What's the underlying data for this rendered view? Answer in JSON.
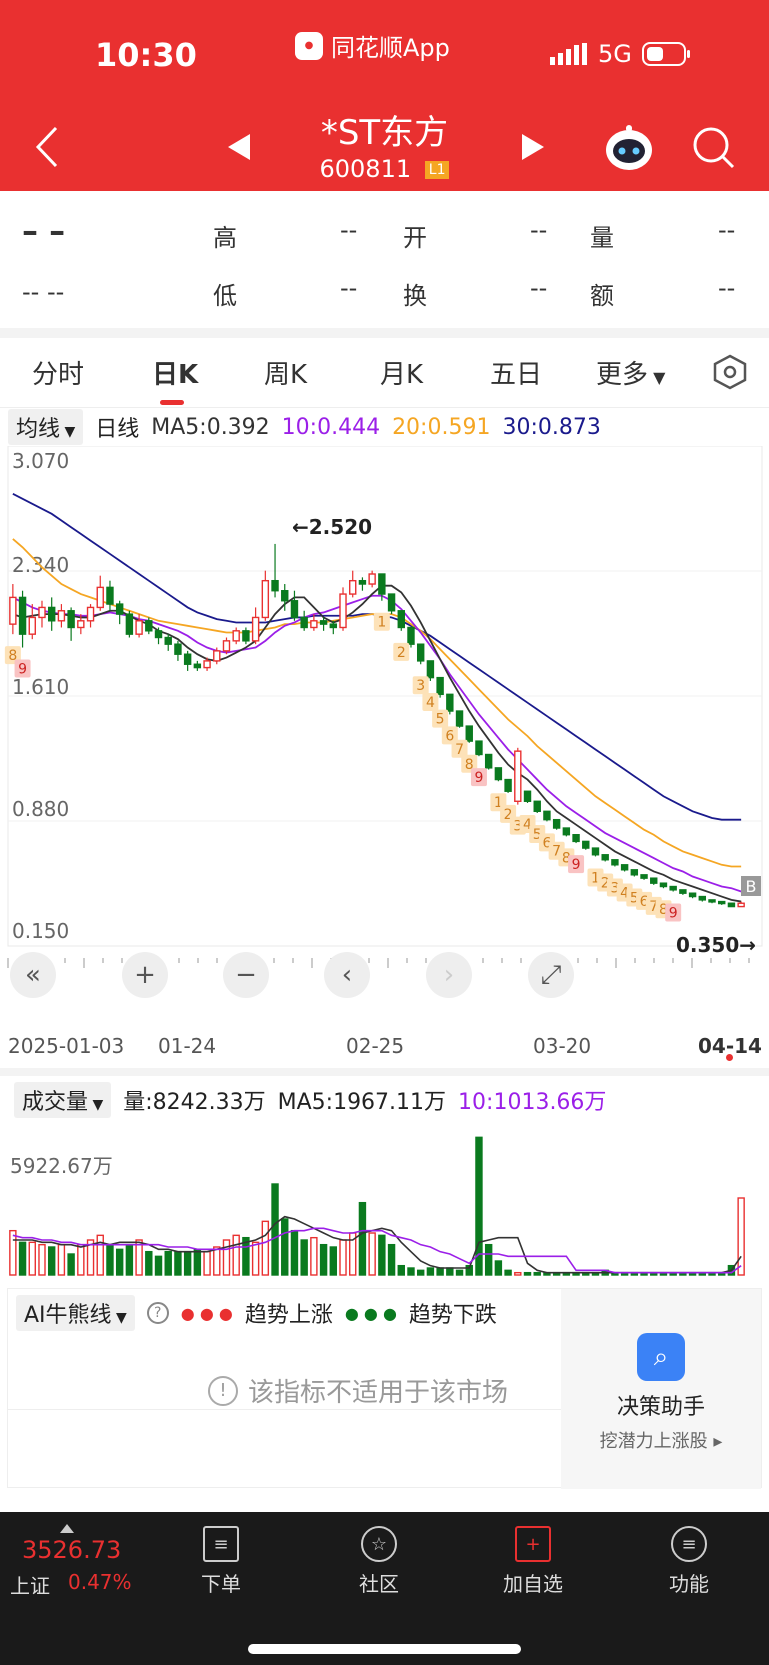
{
  "status": {
    "time": "10:30",
    "app": "同花顺App",
    "network": "5G"
  },
  "header": {
    "title": "*ST东方",
    "code": "600811",
    "badge": "L1"
  },
  "quote": {
    "price": "– –",
    "change": "-- --",
    "labels": [
      "高",
      "开",
      "量",
      "低",
      "换",
      "额"
    ],
    "values": [
      "--",
      "--",
      "--",
      "--",
      "--",
      "--"
    ]
  },
  "tabs": [
    "分时",
    "日K",
    "周K",
    "月K",
    "五日",
    "更多"
  ],
  "ma": {
    "select": "均线",
    "period": "日线",
    "ma5": "MA5:0.392",
    "ma10": "10:0.444",
    "ma20": "20:0.591",
    "ma30": "30:0.873"
  },
  "colors": {
    "red": "#e93030",
    "green": "#0a7a1f",
    "ma5": "#333333",
    "ma10": "#9b1fe8",
    "ma20": "#f5a623",
    "ma30": "#1a1a8c"
  },
  "chart_labels": {
    "high": "←2.520",
    "low": "0.350→",
    "y_ticks": [
      "3.070",
      "2.340",
      "1.610",
      "0.880",
      "0.150"
    ],
    "x_ticks": [
      "2025-01-03",
      "01-24",
      "02-25",
      "03-20",
      "04-14"
    ],
    "marker_b": "B"
  },
  "chart_data": {
    "type": "candlestick",
    "ylim": [
      0.15,
      3.07
    ],
    "x_ticks": [
      "2025-01-03",
      "01-24",
      "02-25",
      "03-20",
      "04-14"
    ],
    "candles": [
      [
        2.04,
        2.2,
        2.28,
        1.98
      ],
      [
        2.2,
        1.98,
        2.24,
        1.9
      ],
      [
        1.98,
        2.08,
        2.16,
        1.95
      ],
      [
        2.08,
        2.14,
        2.18,
        2.02
      ],
      [
        2.14,
        2.06,
        2.2,
        2.0
      ],
      [
        2.06,
        2.12,
        2.16,
        2.02
      ],
      [
        2.12,
        2.02,
        2.14,
        1.94
      ],
      [
        2.02,
        2.06,
        2.1,
        1.98
      ],
      [
        2.06,
        2.14,
        2.16,
        2.02
      ],
      [
        2.14,
        2.26,
        2.33,
        2.12
      ],
      [
        2.26,
        2.16,
        2.3,
        2.12
      ],
      [
        2.16,
        2.1,
        2.18,
        2.04
      ],
      [
        2.1,
        1.98,
        2.12,
        1.96
      ],
      [
        1.98,
        2.06,
        2.1,
        1.96
      ],
      [
        2.06,
        2.0,
        2.08,
        1.98
      ],
      [
        2.0,
        1.96,
        2.02,
        1.92
      ],
      [
        1.96,
        1.92,
        1.98,
        1.88
      ],
      [
        1.92,
        1.86,
        1.94,
        1.82
      ],
      [
        1.86,
        1.8,
        1.88,
        1.76
      ],
      [
        1.8,
        1.78,
        1.82,
        1.76
      ],
      [
        1.78,
        1.82,
        1.84,
        1.76
      ],
      [
        1.82,
        1.88,
        1.9,
        1.8
      ],
      [
        1.88,
        1.94,
        1.96,
        1.86
      ],
      [
        1.94,
        2.0,
        2.02,
        1.92
      ],
      [
        2.0,
        1.94,
        2.02,
        1.92
      ],
      [
        1.94,
        2.08,
        2.14,
        1.92
      ],
      [
        2.08,
        2.3,
        2.36,
        2.06
      ],
      [
        2.3,
        2.24,
        2.52,
        2.2
      ],
      [
        2.24,
        2.18,
        2.28,
        2.12
      ],
      [
        2.18,
        2.08,
        2.24,
        2.06
      ],
      [
        2.08,
        2.02,
        2.12,
        2.0
      ],
      [
        2.02,
        2.06,
        2.1,
        2.0
      ],
      [
        2.06,
        2.04,
        2.08,
        2.0
      ],
      [
        2.04,
        2.02,
        2.06,
        1.98
      ],
      [
        2.02,
        2.22,
        2.26,
        2.0
      ],
      [
        2.22,
        2.3,
        2.36,
        2.2
      ],
      [
        2.3,
        2.28,
        2.32,
        2.24
      ],
      [
        2.28,
        2.34,
        2.36,
        2.26
      ],
      [
        2.34,
        2.22,
        2.34,
        2.18
      ],
      [
        2.22,
        2.12,
        2.22,
        2.1
      ],
      [
        2.12,
        2.02,
        2.12,
        2.0
      ],
      [
        2.02,
        1.92,
        2.02,
        1.9
      ],
      [
        1.92,
        1.82,
        1.92,
        1.8
      ],
      [
        1.82,
        1.72,
        1.82,
        1.7
      ],
      [
        1.72,
        1.62,
        1.72,
        1.6
      ],
      [
        1.62,
        1.52,
        1.62,
        1.5
      ],
      [
        1.52,
        1.43,
        1.52,
        1.42
      ],
      [
        1.43,
        1.34,
        1.43,
        1.33
      ],
      [
        1.34,
        1.26,
        1.34,
        1.25
      ],
      [
        1.26,
        1.18,
        1.26,
        1.17
      ],
      [
        1.18,
        1.11,
        1.18,
        1.1
      ],
      [
        1.11,
        1.04,
        1.11,
        1.03
      ],
      [
        0.98,
        1.28,
        1.3,
        0.96
      ],
      [
        1.04,
        0.98,
        1.04,
        0.97
      ],
      [
        0.98,
        0.92,
        0.98,
        0.91
      ],
      [
        0.92,
        0.87,
        0.92,
        0.86
      ],
      [
        0.87,
        0.82,
        0.87,
        0.81
      ],
      [
        0.82,
        0.78,
        0.82,
        0.77
      ],
      [
        0.78,
        0.74,
        0.78,
        0.73
      ],
      [
        0.74,
        0.7,
        0.74,
        0.69
      ],
      [
        0.7,
        0.66,
        0.7,
        0.65
      ],
      [
        0.66,
        0.63,
        0.66,
        0.62
      ],
      [
        0.63,
        0.6,
        0.63,
        0.59
      ],
      [
        0.6,
        0.57,
        0.6,
        0.56
      ],
      [
        0.57,
        0.54,
        0.57,
        0.53
      ],
      [
        0.54,
        0.52,
        0.54,
        0.51
      ],
      [
        0.52,
        0.49,
        0.52,
        0.48
      ],
      [
        0.49,
        0.47,
        0.49,
        0.46
      ],
      [
        0.47,
        0.45,
        0.47,
        0.44
      ],
      [
        0.45,
        0.43,
        0.45,
        0.42
      ],
      [
        0.43,
        0.41,
        0.43,
        0.4
      ],
      [
        0.41,
        0.39,
        0.41,
        0.38
      ],
      [
        0.39,
        0.38,
        0.39,
        0.37
      ],
      [
        0.38,
        0.37,
        0.38,
        0.36
      ],
      [
        0.37,
        0.35,
        0.37,
        0.35
      ],
      [
        0.35,
        0.37,
        0.38,
        0.35
      ]
    ],
    "ma_values": {
      "ma5": [
        2.1,
        2.08,
        2.09,
        2.1,
        2.1,
        2.1,
        2.09,
        2.08,
        2.08,
        2.1,
        2.12,
        2.12,
        2.09,
        2.06,
        2.04,
        2.0,
        1.98,
        1.95,
        1.9,
        1.86,
        1.83,
        1.82,
        1.84,
        1.87,
        1.9,
        1.94,
        2.02,
        2.1,
        2.16,
        2.2,
        2.2,
        2.14,
        2.08,
        2.05,
        2.07,
        2.11,
        2.16,
        2.22,
        2.27,
        2.27,
        2.23,
        2.15,
        2.05,
        1.94,
        1.83,
        1.72,
        1.62,
        1.52,
        1.43,
        1.35,
        1.27,
        1.2,
        1.15,
        1.11,
        1.05,
        0.98,
        0.92,
        0.88,
        0.84,
        0.8,
        0.76,
        0.72,
        0.68,
        0.65,
        0.62,
        0.59,
        0.56,
        0.54,
        0.51,
        0.49,
        0.47,
        0.45,
        0.43,
        0.41,
        0.39,
        0.38
      ],
      "ma10": [
        2.2,
        2.17,
        2.14,
        2.12,
        2.11,
        2.1,
        2.1,
        2.09,
        2.09,
        2.1,
        2.11,
        2.1,
        2.09,
        2.07,
        2.06,
        2.04,
        2.02,
        2.0,
        1.97,
        1.93,
        1.9,
        1.88,
        1.87,
        1.88,
        1.89,
        1.9,
        1.94,
        1.99,
        2.03,
        2.05,
        2.08,
        2.1,
        2.11,
        2.13,
        2.15,
        2.17,
        2.19,
        2.21,
        2.21,
        2.18,
        2.13,
        2.06,
        1.99,
        1.91,
        1.83,
        1.74,
        1.66,
        1.58,
        1.5,
        1.43,
        1.36,
        1.29,
        1.23,
        1.17,
        1.11,
        1.05,
        1.0,
        0.95,
        0.91,
        0.87,
        0.83,
        0.79,
        0.76,
        0.73,
        0.7,
        0.67,
        0.64,
        0.61,
        0.58,
        0.56,
        0.53,
        0.51,
        0.49,
        0.47,
        0.46,
        0.44
      ],
      "ma20": [
        2.55,
        2.5,
        2.44,
        2.38,
        2.33,
        2.28,
        2.25,
        2.22,
        2.2,
        2.18,
        2.16,
        2.14,
        2.12,
        2.1,
        2.08,
        2.06,
        2.05,
        2.04,
        2.03,
        2.02,
        2.01,
        2.0,
        1.99,
        1.99,
        1.99,
        2.0,
        2.01,
        2.02,
        2.04,
        2.04,
        2.05,
        2.05,
        2.05,
        2.06,
        2.07,
        2.08,
        2.09,
        2.1,
        2.1,
        2.1,
        2.08,
        2.04,
        2.0,
        1.95,
        1.89,
        1.83,
        1.77,
        1.71,
        1.65,
        1.59,
        1.53,
        1.47,
        1.42,
        1.37,
        1.31,
        1.26,
        1.21,
        1.16,
        1.11,
        1.06,
        1.01,
        0.97,
        0.93,
        0.89,
        0.85,
        0.81,
        0.78,
        0.74,
        0.71,
        0.68,
        0.66,
        0.64,
        0.62,
        0.6,
        0.59,
        0.59
      ],
      "ma30": [
        2.82,
        2.79,
        2.76,
        2.73,
        2.7,
        2.66,
        2.62,
        2.58,
        2.54,
        2.5,
        2.46,
        2.42,
        2.38,
        2.34,
        2.3,
        2.26,
        2.22,
        2.18,
        2.14,
        2.11,
        2.09,
        2.07,
        2.06,
        2.05,
        2.05,
        2.05,
        2.05,
        2.06,
        2.07,
        2.08,
        2.08,
        2.09,
        2.09,
        2.09,
        2.09,
        2.09,
        2.1,
        2.1,
        2.09,
        2.08,
        2.06,
        2.03,
        2.0,
        1.97,
        1.93,
        1.89,
        1.85,
        1.81,
        1.77,
        1.73,
        1.69,
        1.65,
        1.61,
        1.57,
        1.53,
        1.49,
        1.45,
        1.41,
        1.37,
        1.33,
        1.29,
        1.25,
        1.21,
        1.17,
        1.13,
        1.09,
        1.05,
        1.01,
        0.98,
        0.95,
        0.92,
        0.9,
        0.88,
        0.87,
        0.87,
        0.87
      ]
    },
    "td_marks": [
      {
        "i": 0,
        "n": "8"
      },
      {
        "i": 1,
        "n": "9"
      },
      {
        "i": 38,
        "n": "1"
      },
      {
        "i": 40,
        "n": "2"
      },
      {
        "i": 42,
        "n": "3"
      },
      {
        "i": 43,
        "n": "4"
      },
      {
        "i": 44,
        "n": "5"
      },
      {
        "i": 45,
        "n": "6"
      },
      {
        "i": 46,
        "n": "7"
      },
      {
        "i": 47,
        "n": "8"
      },
      {
        "i": 48,
        "n": "9"
      },
      {
        "i": 50,
        "n": "1"
      },
      {
        "i": 51,
        "n": "2"
      },
      {
        "i": 52,
        "n": "3"
      },
      {
        "i": 53,
        "n": "4"
      },
      {
        "i": 54,
        "n": "5"
      },
      {
        "i": 55,
        "n": "6"
      },
      {
        "i": 56,
        "n": "7"
      },
      {
        "i": 57,
        "n": "8"
      },
      {
        "i": 58,
        "n": "9"
      },
      {
        "i": 60,
        "n": "1"
      },
      {
        "i": 61,
        "n": "2"
      },
      {
        "i": 62,
        "n": "3"
      },
      {
        "i": 63,
        "n": "4"
      },
      {
        "i": 64,
        "n": "5"
      },
      {
        "i": 65,
        "n": "6"
      },
      {
        "i": 66,
        "n": "7"
      },
      {
        "i": 67,
        "n": "8"
      },
      {
        "i": 68,
        "n": "9"
      }
    ],
    "volume": [
      1.9,
      1.4,
      1.4,
      1.3,
      1.2,
      1.3,
      0.9,
      1.3,
      1.5,
      1.7,
      1.3,
      1.1,
      1.3,
      1.5,
      1.0,
      0.8,
      1.0,
      1.0,
      1.0,
      1.1,
      1.0,
      1.2,
      1.5,
      1.7,
      1.6,
      1.4,
      2.3,
      3.9,
      2.4,
      1.9,
      1.5,
      1.6,
      1.3,
      1.2,
      1.5,
      1.8,
      3.1,
      1.8,
      1.7,
      1.3,
      0.4,
      0.3,
      0.2,
      0.3,
      0.3,
      0.3,
      0.2,
      0.4,
      5.9,
      1.3,
      0.6,
      0.2,
      0.1,
      0.1,
      0.1,
      0.1,
      0.1,
      0.1,
      0.1,
      0.1,
      0.1,
      0.2,
      0.1,
      0.1,
      0.1,
      0.1,
      0.1,
      0.1,
      0.1,
      0.1,
      0.1,
      0.1,
      0.1,
      0.1,
      0.4,
      3.3
    ],
    "vol_ma5": [
      1.5,
      1.5,
      1.5,
      1.4,
      1.4,
      1.3,
      1.3,
      1.2,
      1.3,
      1.4,
      1.3,
      1.4,
      1.4,
      1.4,
      1.3,
      1.1,
      1.1,
      1.0,
      1.0,
      1.0,
      1.0,
      1.1,
      1.2,
      1.3,
      1.4,
      1.5,
      1.7,
      2.2,
      2.5,
      2.4,
      2.2,
      2.0,
      1.8,
      1.6,
      1.5,
      1.5,
      1.8,
      1.9,
      2.0,
      1.9,
      1.4,
      1.0,
      0.6,
      0.4,
      0.3,
      0.3,
      0.3,
      0.3,
      1.4,
      1.5,
      1.6,
      1.6,
      1.6,
      0.5,
      0.2,
      0.1,
      0.1,
      0.1,
      0.1,
      0.1,
      0.1,
      0.1,
      0.1,
      0.1,
      0.1,
      0.1,
      0.1,
      0.1,
      0.1,
      0.1,
      0.1,
      0.1,
      0.1,
      0.1,
      0.2,
      0.8
    ],
    "vol_ma10": [
      1.7,
      1.6,
      1.6,
      1.5,
      1.5,
      1.4,
      1.4,
      1.3,
      1.3,
      1.3,
      1.3,
      1.3,
      1.3,
      1.3,
      1.3,
      1.3,
      1.2,
      1.2,
      1.2,
      1.1,
      1.1,
      1.1,
      1.1,
      1.2,
      1.2,
      1.3,
      1.4,
      1.6,
      1.8,
      1.9,
      1.9,
      2.0,
      2.0,
      1.9,
      1.8,
      1.8,
      1.9,
      1.9,
      1.9,
      1.7,
      1.6,
      1.5,
      1.3,
      1.2,
      1.0,
      0.9,
      0.7,
      0.5,
      0.9,
      0.9,
      0.9,
      0.8,
      0.8,
      0.8,
      0.8,
      0.8,
      0.8,
      0.8,
      0.2,
      0.2,
      0.2,
      0.2,
      0.1,
      0.1,
      0.1,
      0.1,
      0.1,
      0.1,
      0.1,
      0.1,
      0.1,
      0.1,
      0.1,
      0.1,
      0.1,
      0.4
    ]
  },
  "volume_header": {
    "select": "成交量",
    "vol": "量:8242.33万",
    "ma5": "MA5:1967.11万",
    "ma10": "10:1013.66万",
    "y_label": "5922.67万"
  },
  "ai": {
    "select": "AI牛熊线",
    "up": "趋势上涨",
    "down": "趋势下跌",
    "message": "该指标不适用于该市场",
    "assistant_title": "决策助手",
    "assistant_sub": "挖潜力上涨股"
  },
  "bottom": {
    "index_value": "3526.73",
    "index_name": "上证",
    "index_change": "0.47%",
    "items": [
      "下单",
      "社区",
      "加自选",
      "功能"
    ]
  }
}
